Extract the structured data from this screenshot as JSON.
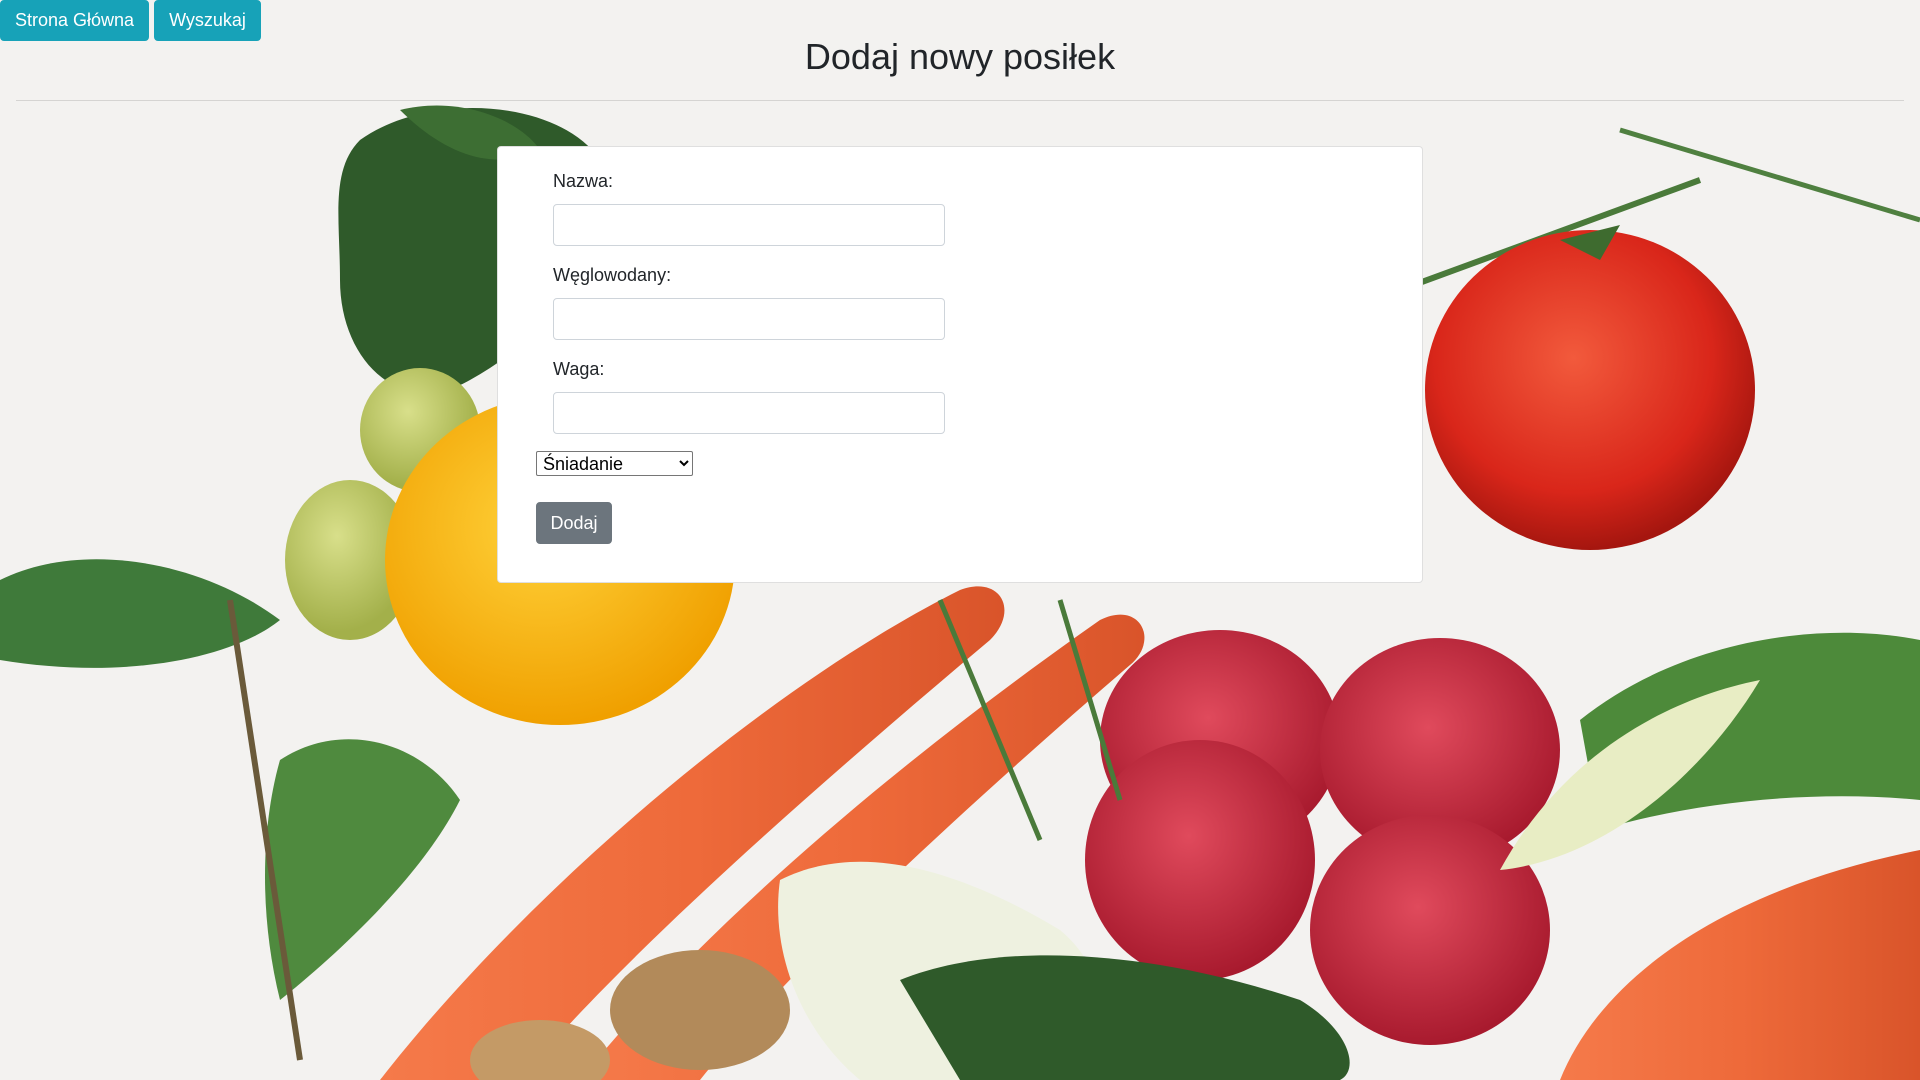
{
  "nav": {
    "home_label": "Strona Główna",
    "search_label": "Wyszukaj"
  },
  "page": {
    "title": "Dodaj nowy posiłek"
  },
  "form": {
    "name_label": "Nazwa:",
    "name_value": "",
    "carbs_label": "Węglowodany:",
    "carbs_value": "",
    "weight_label": "Waga:",
    "weight_value": "",
    "meal_type_selected": "Śniadanie",
    "submit_label": "Dodaj"
  },
  "colors": {
    "nav_button": "#17a2b8",
    "submit_button": "#6c757d",
    "card_background": "#ffffff"
  },
  "background": {
    "image": "vegetables-photo"
  }
}
